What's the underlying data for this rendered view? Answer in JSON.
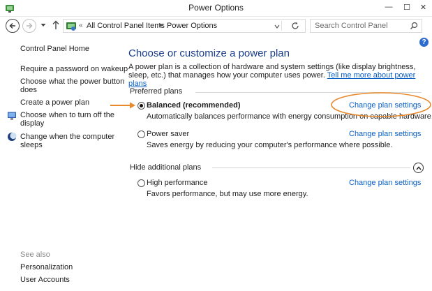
{
  "window": {
    "title": "Power Options",
    "minimize_symbol": "—",
    "maximize_symbol": "☐",
    "close_symbol": "✕"
  },
  "address": {
    "chevrons": "«",
    "breadcrumbs": [
      "All Control Panel Items",
      "Power Options"
    ],
    "separator": "▶",
    "search_placeholder": "Search Control Panel"
  },
  "icons": {
    "back": "arrow-left-icon",
    "forward": "arrow-right-icon",
    "recent": "chevron-down-icon",
    "up": "arrow-up-icon",
    "refresh": "refresh-icon",
    "search": "search-icon",
    "help": "help-icon",
    "collapse": "chevron-up-icon"
  },
  "sidebar": {
    "home_label": "Control Panel Home",
    "links": [
      "Require a password on wakeup",
      "Choose what the power button does",
      "Create a power plan",
      "Choose when to turn off the display",
      "Change when the computer sleeps"
    ],
    "link_lines": {
      "power_button": [
        "Choose what the power button",
        "does"
      ],
      "turn_off_display": [
        "Choose when to turn off the",
        "display"
      ],
      "sleep": [
        "Change when the computer",
        "sleeps"
      ]
    },
    "see_also_label": "See also",
    "see_also": [
      "Personalization",
      "User Accounts"
    ]
  },
  "main": {
    "help_glyph": "?",
    "title": "Choose or customize a power plan",
    "intro_text": "A power plan is a collection of hardware and system settings (like display brightness, sleep, etc.) that manages how your computer uses power.",
    "intro_link": "Tell me more about power plans",
    "preferred_label": "Preferred plans",
    "hide_label": "Hide additional plans",
    "change_link_label": "Change plan settings",
    "plans": [
      {
        "name": "Balanced (recommended)",
        "description": "Automatically balances performance with energy consumption on capable hardware.",
        "selected": true
      },
      {
        "name": "Power saver",
        "description": "Saves energy by reducing your computer's performance where possible.",
        "selected": false
      },
      {
        "name": "High performance",
        "description": "Favors performance, but may use more energy.",
        "selected": false
      }
    ]
  },
  "colors": {
    "title_blue": "#1a3c88",
    "link_blue": "#0a5fc4",
    "annotation_orange": "#e8892b"
  }
}
